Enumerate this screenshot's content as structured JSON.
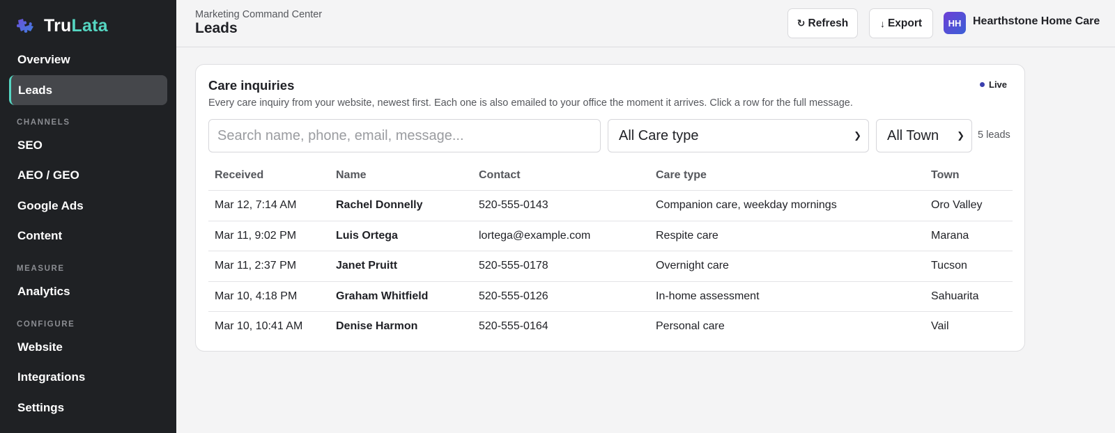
{
  "brand": {
    "part1": "Tru",
    "part2": "Lata",
    "logo_icon": "puzzle-logo-icon"
  },
  "sidebar": {
    "overview": "Overview",
    "leads": "Leads",
    "section_channels": "CHANNELS",
    "seo": "SEO",
    "aeo_geo": "AEO / GEO",
    "google_ads": "Google Ads",
    "content": "Content",
    "section_measure": "MEASURE",
    "analytics": "Analytics",
    "section_configure": "CONFIGURE",
    "website": "Website",
    "integrations": "Integrations",
    "settings": "Settings"
  },
  "header": {
    "breadcrumb": "Marketing Command Center",
    "title": "Leads",
    "refresh_label": "Refresh",
    "refresh_icon": "↻",
    "export_label": "Export",
    "export_icon": "↓",
    "avatar_initials": "HH",
    "org_name": "Hearthstone Home Care"
  },
  "card": {
    "title": "Care inquiries",
    "subtitle": "Every care inquiry from your website, newest first. Each one is also emailed to your office the moment it arrives. Click a row for the full message.",
    "live_label": "Live"
  },
  "filters": {
    "search_placeholder": "Search name, phone, email, message...",
    "care_type_selected": "All Care type",
    "town_selected": "All Town",
    "lead_count": "5 leads"
  },
  "table": {
    "headers": {
      "received": "Received",
      "name": "Name",
      "contact": "Contact",
      "care_type": "Care type",
      "town": "Town"
    },
    "rows": [
      {
        "received": "Mar 12, 7:14 AM",
        "name": "Rachel Donnelly",
        "contact": "520-555-0143",
        "care_type": "Companion care, weekday mornings",
        "town": "Oro Valley"
      },
      {
        "received": "Mar 11, 9:02 PM",
        "name": "Luis Ortega",
        "contact": "lortega@example.com",
        "care_type": "Respite care",
        "town": "Marana"
      },
      {
        "received": "Mar 11, 2:37 PM",
        "name": "Janet Pruitt",
        "contact": "520-555-0178",
        "care_type": "Overnight care",
        "town": "Tucson"
      },
      {
        "received": "Mar 10, 4:18 PM",
        "name": "Graham Whitfield",
        "contact": "520-555-0126",
        "care_type": "In-home assessment",
        "town": "Sahuarita"
      },
      {
        "received": "Mar 10, 10:41 AM",
        "name": "Denise Harmon",
        "contact": "520-555-0164",
        "care_type": "Personal care",
        "town": "Vail"
      }
    ]
  },
  "colors": {
    "sidebar_bg": "#1f2124",
    "accent": "#55d6c2",
    "live_dot": "#3b3fae"
  }
}
